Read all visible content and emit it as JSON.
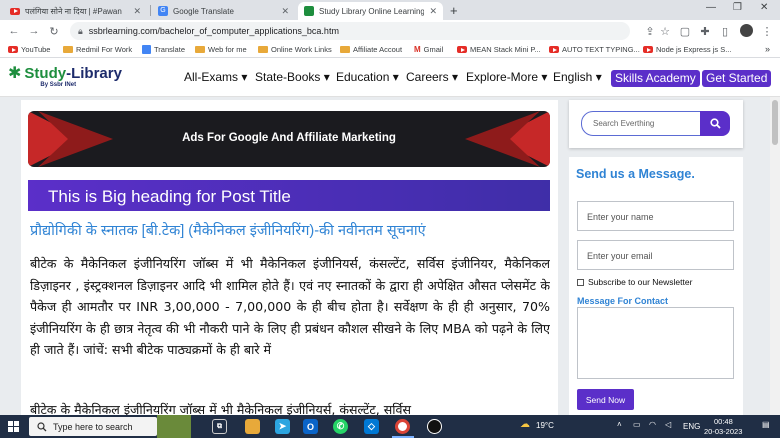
{
  "browser": {
    "tabs": [
      {
        "title": "पलंगिया सोने ना दिया | #Pawan",
        "icon": "youtube-icon"
      },
      {
        "title": "Google Translate",
        "icon": "translate-icon"
      },
      {
        "title": "Study Library Online Learning",
        "icon": "study-library-icon"
      }
    ],
    "url": "ssbrlearning.com/bachelor_of_computer_applications_bca.htm",
    "bookmarks": [
      "YouTube",
      "Redmil For Work",
      "Translate",
      "Web for me",
      "Online Work Links",
      "Affiliate Accout",
      "Gmail",
      "MEAN Stack Mini P...",
      "AUTO TEXT TYPING...",
      "Node js Express js S..."
    ]
  },
  "site": {
    "logo": {
      "mark": "✱",
      "name_a": "Study",
      "name_b": "-Library",
      "tagline": "By Ssbr INet"
    },
    "nav": [
      "All-Exams ▾",
      "State-Books ▾",
      "Education ▾",
      "Careers ▾",
      "Explore-More ▾",
      "English ▾"
    ],
    "nav_buttons": [
      "Skills Academy",
      "Get Started"
    ]
  },
  "main": {
    "ad_text": "Ads For Google And Affiliate Marketing",
    "hero_title": "This is Big heading for Post Title",
    "hindi_heading": "प्रौद्योगिकी के स्नातक [बी.टेक] (मैकेनिकल इंजीनियरिंग)-की नवीनतम सूचनाएं",
    "paragraph1": "बीटेक के मैकेनिकल इंजीनियरिंग जॉब्स में भी मैकेनिकल इंजीनियर्स, कंसल्टेंट, सर्विस इंजीनियर, मैकेनिकल डिज़ाइनर , इंस्ट्रक्शनल डिज़ाइनर आदि भी शामिल होते हैं। एवं नए स्नातकों के द्वारा ही अपेक्षित औसत प्लेसमेंट के पैकेज ही आमतौर पर INR 3,00,000 - 7,00,000 के ही बीच होता है। सर्वेक्षण के ही ही अनुसार, 70% इंजीनियरिंग के ही छात्र नेतृत्व की भी नौकरी पाने के लिए ही प्रबंधन कौशल सीखने के लिए MBA को पढ़ने के लिए ही जाते हैं। जांचें: सभी बीटेक पाठ्यक्रमों के ही बारे में",
    "paragraph2": "बीटेक के मैकेनिकल इंजीनियरिंग जॉब्स में भी मैकेनिकल इंजीनियर्स, कंसल्टेंट, सर्विस"
  },
  "sidebar": {
    "search_placeholder": "Search Everthing",
    "contact_title": "Send us a Message.",
    "name_placeholder": "Enter your name",
    "email_placeholder": "Enter your email",
    "subscribe_label": "Subscribe to our Newsletter",
    "message_label": "Message For Contact",
    "send_label": "Send Now"
  },
  "taskbar": {
    "search_placeholder": "Type here to search",
    "temperature": "19°C",
    "language": "ENG",
    "time": "00:48",
    "date": "20-03-2023"
  },
  "colors": {
    "accent": "#5b2fc9",
    "link_blue": "#2f83d4",
    "brand_green": "#1e8e3e"
  }
}
